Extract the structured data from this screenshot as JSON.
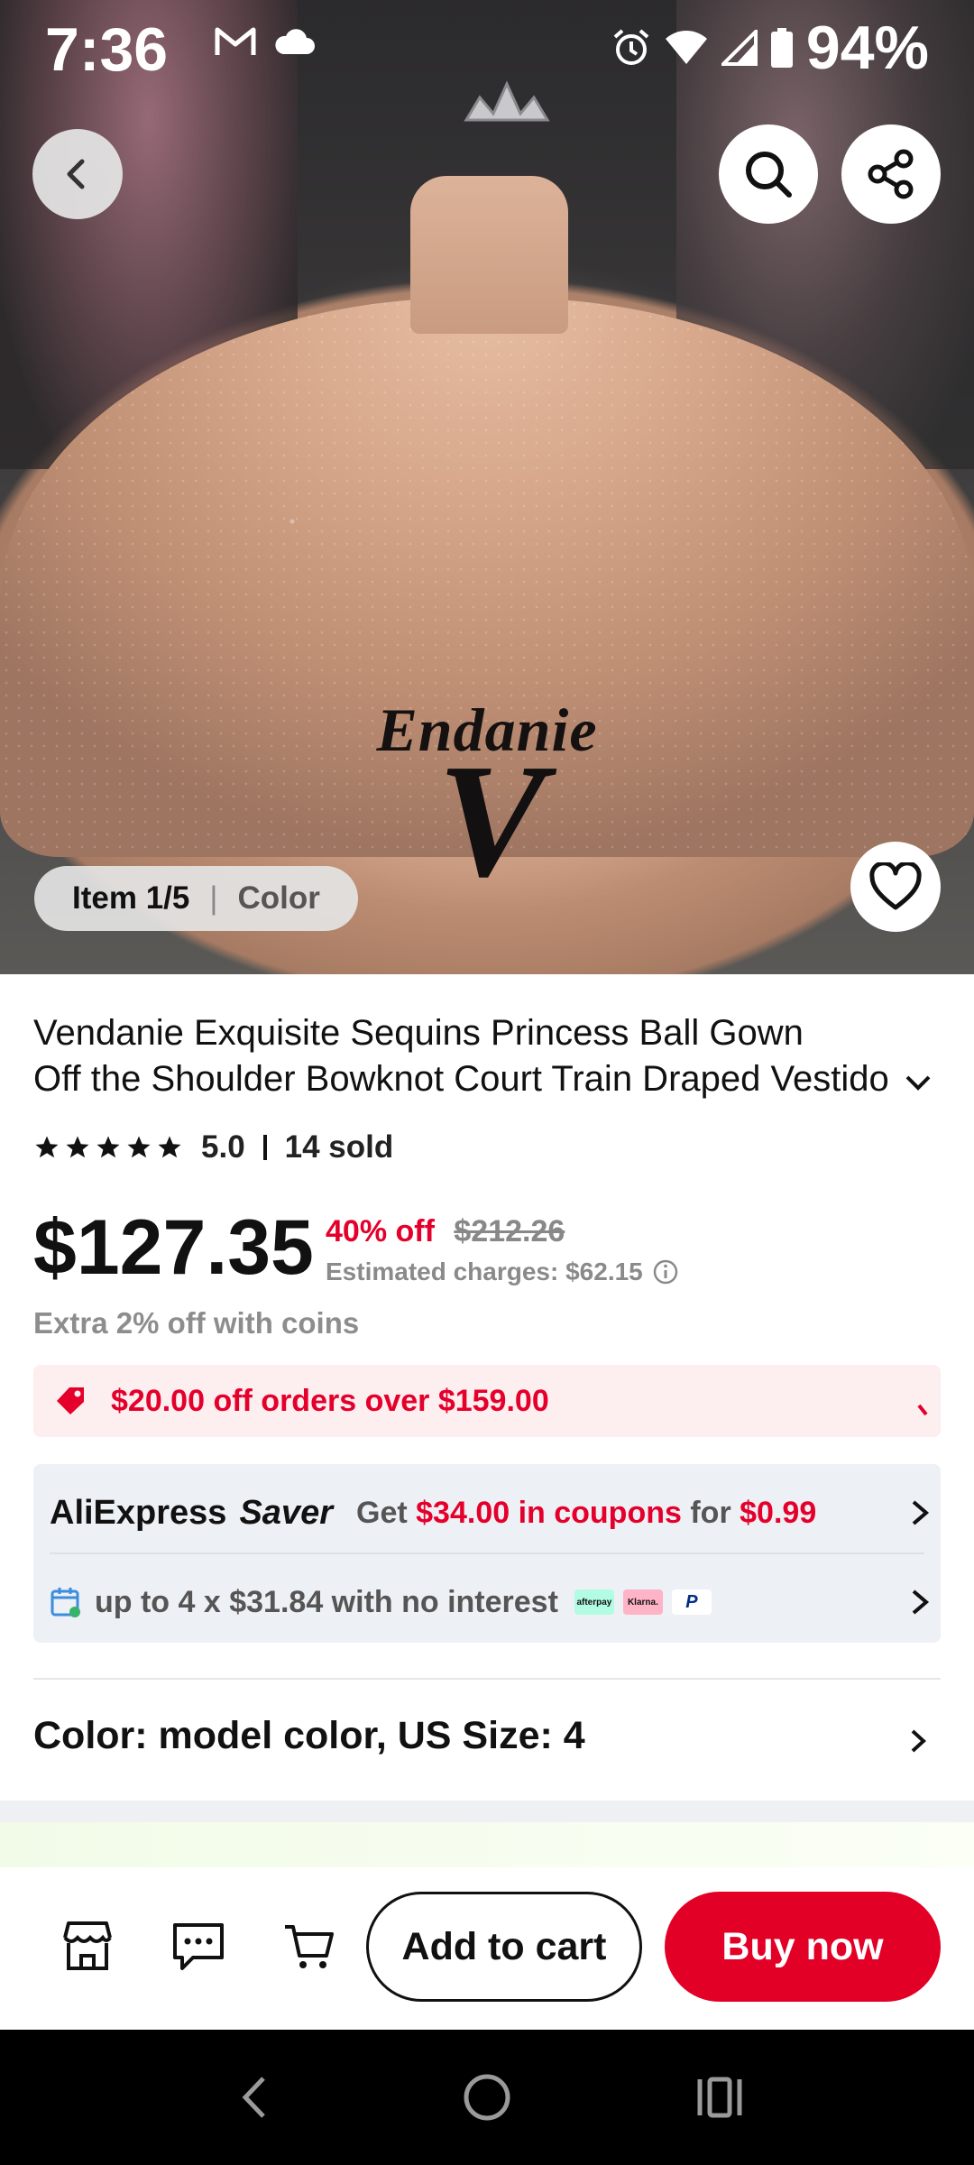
{
  "status_bar": {
    "time": "7:36",
    "battery_text": "94%",
    "left_icons": [
      "gmail-icon",
      "cloud-icon"
    ],
    "right_icons": [
      "alarm-icon",
      "wifi-icon",
      "signal-icon",
      "battery-icon"
    ]
  },
  "hero": {
    "watermark_word": "Endanie",
    "watermark_letter": "V",
    "item_pill": {
      "item": "Item 1/5",
      "color": "Color"
    }
  },
  "product": {
    "title_line1": "Vendanie Exquisite Sequins Princess Ball Gown",
    "title_line2": "Off the Shoulder Bowknot Court Train Draped Vestido",
    "rating": "5.0",
    "sold": "14 sold",
    "stars": 5,
    "price": "$127.35",
    "discount_pct": "40% off",
    "original_price": "$212.26",
    "estimated_charges": "Estimated charges: $62.15",
    "coins_text": "Extra 2% off with coins"
  },
  "coupon": {
    "text": "$20.00 off orders over $159.00"
  },
  "saver": {
    "brand": "AliExpress",
    "saver_logo": "Saver",
    "get": "Get",
    "coupons_amount": "$34.00 in coupons",
    "for": "for",
    "price": "$0.99",
    "installments_text": "up to 4 x $31.84 with no interest",
    "payment_logos": [
      "afterpay",
      "Klarna.",
      "P"
    ]
  },
  "variant": {
    "text": "Color: model color, US Size: 4"
  },
  "bottom_bar": {
    "add_to_cart": "Add to cart",
    "buy_now": "Buy now"
  },
  "colors": {
    "accent_red": "#e20027",
    "price_red": "#e4002b",
    "coupon_bg": "#fdeef0",
    "saver_bg": "#edf0f5"
  }
}
